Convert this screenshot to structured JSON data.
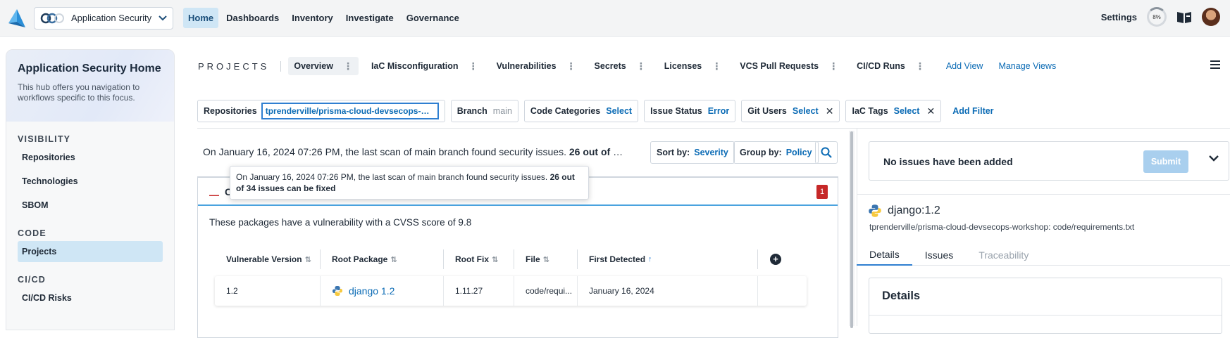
{
  "topbar": {
    "app_name": "Application Security",
    "nav": [
      "Home",
      "Dashboards",
      "Inventory",
      "Investigate",
      "Governance"
    ],
    "settings": "Settings",
    "progress_label": "8%"
  },
  "sidebar": {
    "title": "Application Security Home",
    "subtitle": "This hub offers you navigation to workflows specific to this focus.",
    "sections": [
      {
        "title": "VISIBILITY",
        "items": [
          "Repositories",
          "Technologies",
          "SBOM"
        ]
      },
      {
        "title": "CODE",
        "items": [
          "Projects"
        ]
      },
      {
        "title": "CI/CD",
        "items": [
          "CI/CD Risks"
        ]
      }
    ],
    "selected": "Projects"
  },
  "projects": {
    "label": "PROJECTS",
    "tabs": [
      "Overview",
      "IaC Misconfiguration",
      "Vulnerabilities",
      "Secrets",
      "Licenses",
      "VCS Pull Requests",
      "CI/CD Runs"
    ],
    "add_view": "Add View",
    "manage_views": "Manage Views"
  },
  "filters": {
    "repositories_label": "Repositories",
    "repositories_value": "tprenderville/prisma-cloud-devsecops-work...",
    "branch_label": "Branch",
    "branch_value": "main",
    "code_categories_label": "Code Categories",
    "code_categories_value": "Select",
    "issue_status_label": "Issue Status",
    "issue_status_value": "Error",
    "git_users_label": "Git Users",
    "git_users_value": "Select",
    "iac_tags_label": "IaC Tags",
    "iac_tags_value": "Select",
    "add_filter": "Add Filter"
  },
  "summary": {
    "text": "On January 16, 2024 07:26 PM, the last scan of main branch found security issues.",
    "bold": "26 out of 34…",
    "sort_label": "Sort by:",
    "sort_value": "Severity",
    "group_label": "Group by:",
    "group_value": "Policy"
  },
  "tooltip": {
    "text": "On January 16, 2024 07:26 PM, the last scan of main branch found security issues.",
    "bold": "26 out of 34 issues can be fixed"
  },
  "group": {
    "title_initial": "C",
    "count": "1",
    "description": "These packages have a vulnerability with a CVSS score of 9.8",
    "columns": [
      "Vulnerable Version",
      "Root Package",
      "Root Fix",
      "File",
      "First Detected"
    ],
    "row": {
      "vulnerable_version": "1.2",
      "root_package": "django 1.2",
      "root_fix": "1.11.27",
      "file": "code/requi...",
      "first_detected": "January 16, 2024"
    }
  },
  "right_panel": {
    "no_issues": "No issues have been added",
    "submit": "Submit",
    "package": "django:1.2",
    "path": "tprenderville/prisma-cloud-devsecops-workshop: code/requirements.txt",
    "tabs": [
      "Details",
      "Issues",
      "Traceability"
    ],
    "details_title": "Details"
  },
  "colors": {
    "accent": "#0b6bb5",
    "active_nav_bg": "#cfe6f5",
    "error_badge": "#c62828",
    "submit_disabled": "#a9cfee"
  }
}
